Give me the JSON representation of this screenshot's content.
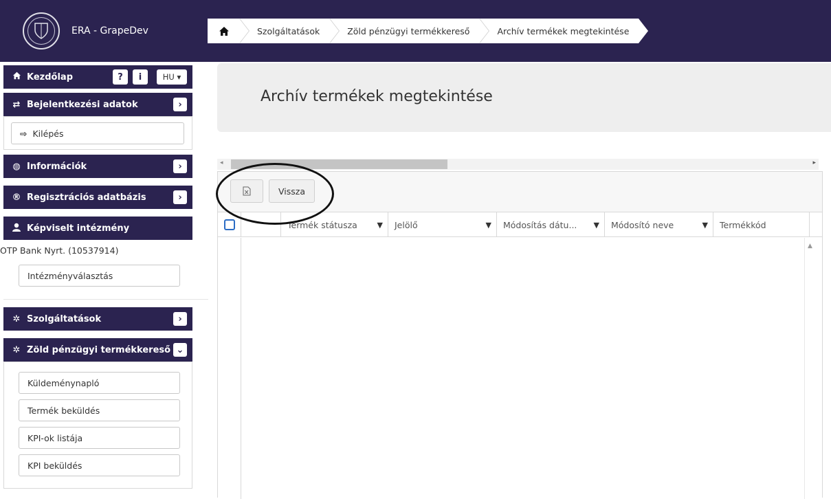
{
  "app": {
    "title": "ERA - GrapeDev"
  },
  "breadcrumb": {
    "home_icon": "home-icon",
    "items": [
      "Szolgáltatások",
      "Zöld pénzügyi termékkereső",
      "Archív termékek megtekintése"
    ]
  },
  "sidebar": {
    "home": {
      "label": "Kezdőlap",
      "lang": "HU"
    },
    "login": {
      "label": "Bejelentkezési adatok",
      "logout": "Kilépés"
    },
    "info": {
      "label": "Információk"
    },
    "registry": {
      "label": "Regisztrációs adatbázis"
    },
    "represented": {
      "label": "Képviselt intézmény",
      "institution": "OTP Bank Nyrt. (10537914)",
      "select": "Intézményválasztás"
    },
    "services": {
      "label": "Szolgáltatások"
    },
    "green": {
      "label": "Zöld pénzügyi termékkereső",
      "items": [
        "Küldeménynapló",
        "Termék beküldés",
        "KPI-ok listája",
        "KPI beküldés"
      ]
    }
  },
  "main": {
    "title": "Archív termékek megtekintése",
    "toolbar": {
      "back": "Vissza",
      "excel_icon": "excel-export-icon"
    },
    "columns": [
      "Termék státusza",
      "Jelölő",
      "Módosítás dátu...",
      "Módosító neve",
      "Termékkód"
    ]
  },
  "colors": {
    "primary": "#2b2350",
    "header_bg": "#eeeeee",
    "checkbox": "#2b6cc4"
  }
}
